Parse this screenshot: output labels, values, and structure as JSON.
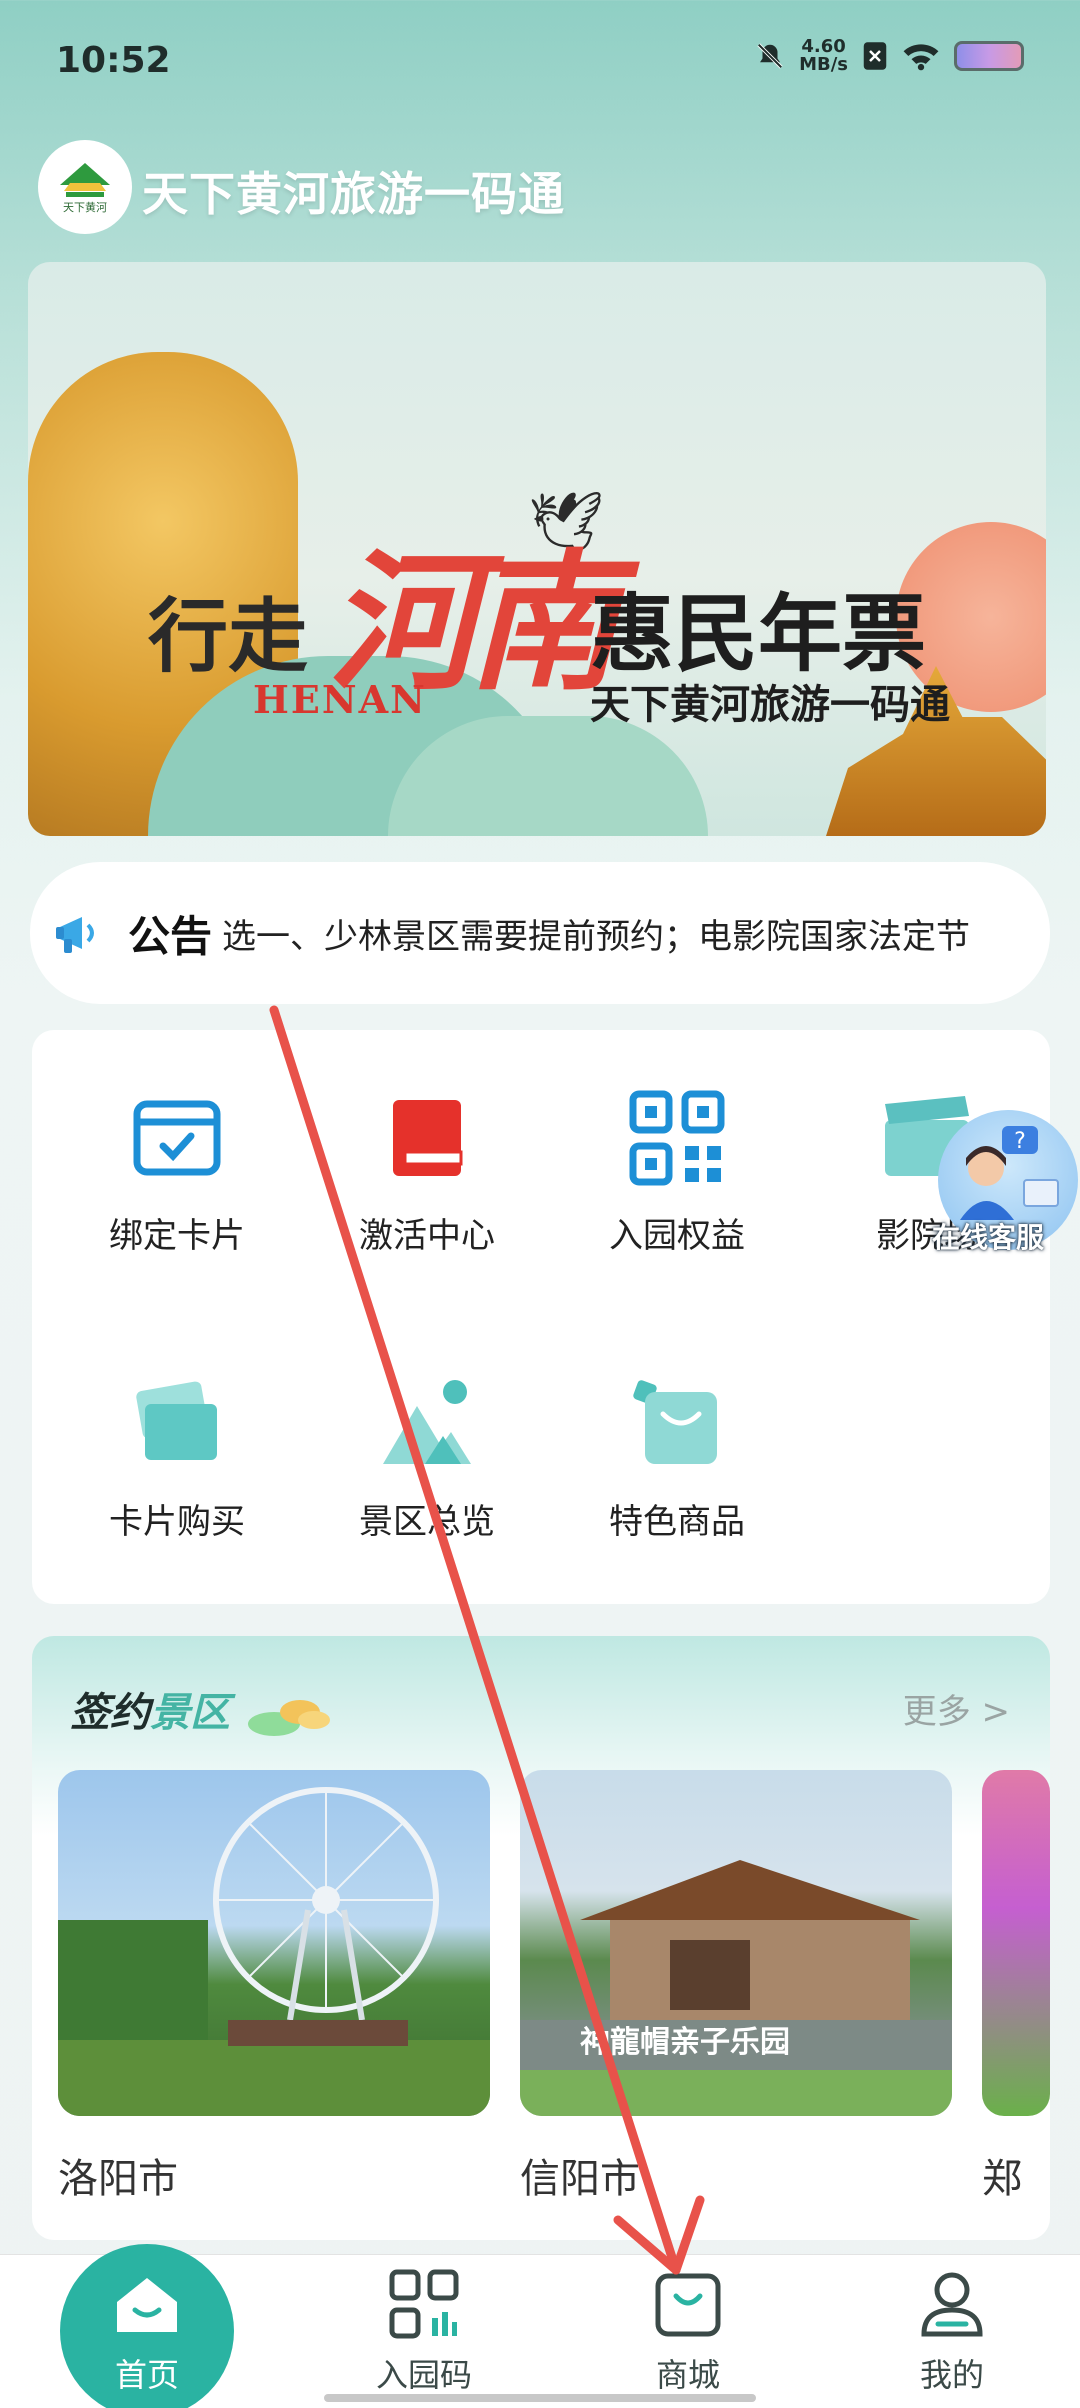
{
  "status_bar": {
    "time": "10:52",
    "net_speed_value": "4.60",
    "net_speed_unit": "MB/s"
  },
  "header": {
    "logo_text": "天下黄河",
    "title": "天下黄河旅游一码通"
  },
  "banner": {
    "line_left": "行走",
    "henan_cn": "河南",
    "henan_en": "HENAN",
    "line_right": "惠民年票",
    "subtitle": "天下黄河旅游一码通",
    "dots_count": 6,
    "active_dot": 1
  },
  "notice": {
    "label": "公告",
    "text": "选一、少林景区需要提前预约；电影院国家法定节"
  },
  "grid": {
    "items": [
      {
        "label": "绑定卡片",
        "icon": "card-bind-icon"
      },
      {
        "label": "激活中心",
        "icon": "book-icon"
      },
      {
        "label": "入园权益",
        "icon": "qr-code-icon"
      },
      {
        "label": "影院场",
        "icon": "cinema-icon"
      },
      {
        "label": "卡片购买",
        "icon": "card-buy-icon"
      },
      {
        "label": "景区总览",
        "icon": "mountain-icon"
      },
      {
        "label": "特色商品",
        "icon": "shopping-bag-icon"
      }
    ]
  },
  "floating_service": {
    "label": "在线客服"
  },
  "signed_scenic": {
    "title_part1": "签约",
    "title_part2": "景区",
    "more": "更多 >",
    "items": [
      {
        "city": "洛阳市"
      },
      {
        "city": "信阳市"
      },
      {
        "city": "郑"
      }
    ],
    "photo_caption": "神龍帽亲子乐园"
  },
  "bottom_nav": {
    "items": [
      {
        "label": "首页",
        "icon": "home-icon",
        "active": true
      },
      {
        "label": "入园码",
        "icon": "entry-code-icon",
        "active": false
      },
      {
        "label": "商城",
        "icon": "shop-bag-icon",
        "active": false
      },
      {
        "label": "我的",
        "icon": "profile-icon",
        "active": false
      }
    ]
  },
  "colors": {
    "accent": "#2ab3a2",
    "annotation_arrow": "#e8524a"
  }
}
